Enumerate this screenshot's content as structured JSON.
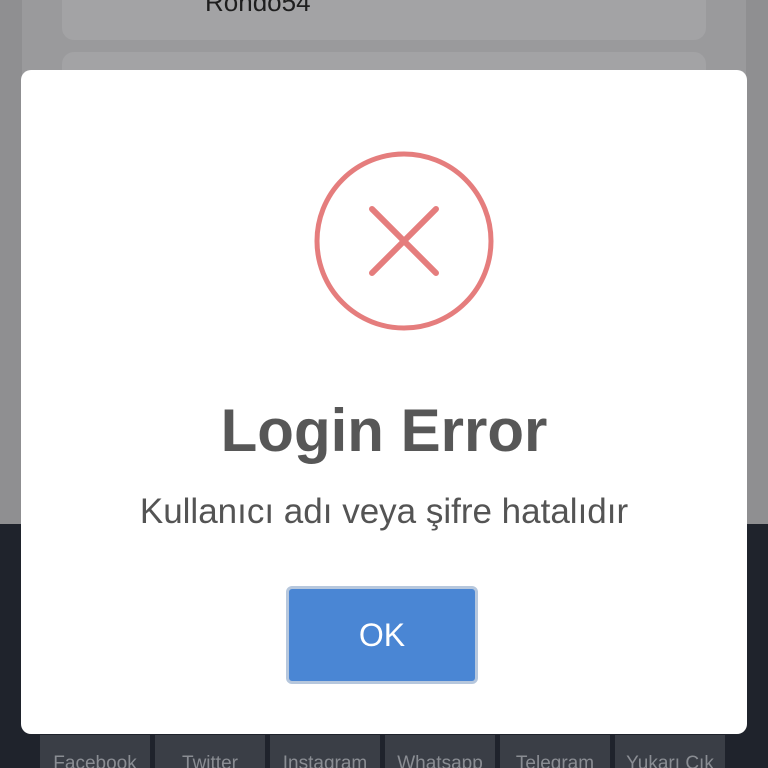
{
  "background": {
    "card_text": "Rondo54",
    "social_buttons": [
      {
        "label": "Facebook",
        "icon": "facebook-icon"
      },
      {
        "label": "Twitter",
        "icon": "twitter-icon"
      },
      {
        "label": "Instagram",
        "icon": "instagram-icon"
      },
      {
        "label": "Whatsapp",
        "icon": "whatsapp-icon"
      },
      {
        "label": "Telegram",
        "icon": "telegram-icon"
      },
      {
        "label": "Yukarı Çık",
        "icon": "arrow-up-icon"
      }
    ]
  },
  "dialog": {
    "icon": "error-x-icon",
    "title": "Login Error",
    "message": "Kullanıcı adı veya şifre hatalıdır",
    "ok_label": "OK"
  },
  "colors": {
    "error_red": "#e57d7d",
    "button_blue": "#4a86d4",
    "footer_dark": "#1f232c"
  }
}
